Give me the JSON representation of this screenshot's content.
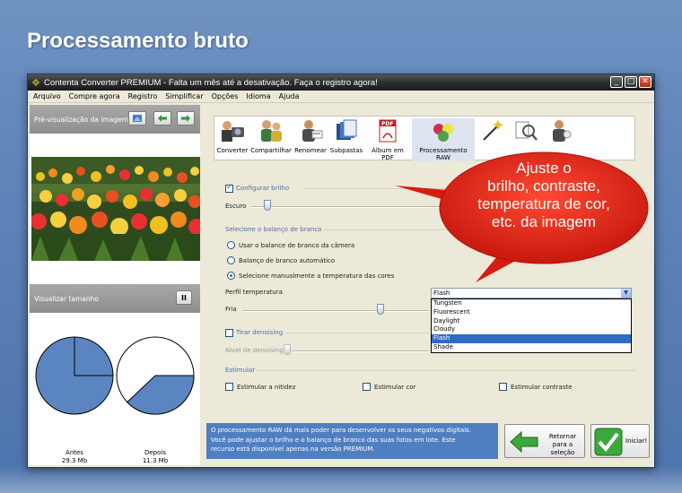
{
  "slide": {
    "title": "Processamento bruto"
  },
  "window": {
    "title": "Contenta Converter PREMIUM  - Falta um mês até a desativação. Faça o registro agora!",
    "buttons": {
      "minimize": "_",
      "maximize": "□",
      "close": "✕"
    }
  },
  "menu": [
    "Arquivo",
    "Compre agora",
    "Registro",
    "Simplificar",
    "Opções",
    "Idioma",
    "Ajuda"
  ],
  "preview": {
    "header": "Pré-visualização da imagem",
    "size_header": "Visualizar tamanho",
    "pause_label": "II"
  },
  "sizes": {
    "before_label": "Antes",
    "before_value": "29.3 Mb",
    "after_label": "Depois",
    "after_value": "11.3 Mb"
  },
  "toolbar": [
    {
      "label": "Converter",
      "icon": "camera-person-icon"
    },
    {
      "label": "Compartilhar",
      "icon": "people-icon"
    },
    {
      "label": "Renomear",
      "icon": "person-rename-icon"
    },
    {
      "label": "Subpastas",
      "icon": "folders-icon"
    },
    {
      "label": "Álbum em PDF",
      "icon": "pdf-icon"
    },
    {
      "label": "Processamento RAW",
      "icon": "color-balls-icon"
    },
    {
      "label": "",
      "icon": "magic-wand-icon"
    },
    {
      "label": "",
      "icon": "magnifier-icon"
    },
    {
      "label": "",
      "icon": "person-gear-icon"
    }
  ],
  "brightness": {
    "checkbox_label": "Configurar brilho",
    "dark_label": "Escuro"
  },
  "white_balance": {
    "group_label": "Selecione o balanço de branco",
    "options": [
      "Usar o balance de branco da câmera",
      "Balanço de branco automático",
      "Selecione manualmente a temperatura das cores"
    ],
    "profile_label": "Perfil temperatura",
    "profile_value": "Flash",
    "profile_options": [
      "Tungsten",
      "Fluorescent",
      "Daylight",
      "Cloudy",
      "Flash",
      "Shade"
    ],
    "cold_label": "Fria"
  },
  "denoise": {
    "checkbox_label": "Tirar denoising",
    "level_label": "Nível de denoising"
  },
  "stimulate": {
    "group_label": "Estimular",
    "options": [
      "Estimular a nitidez",
      "Estimular cor",
      "Estimular contraste"
    ]
  },
  "info_text": [
    "O processamento RAW dá mais poder para desenvolver os seus negativos digitais.",
    "Você pode ajustar o brilho e o balanço de branco das suas fotos em lote. Este",
    "recurso está disponível apenas na versão PREMIUM."
  ],
  "actions": {
    "back_line1": "Retornar",
    "back_line2": "para a seleção",
    "start": "Iniciar!"
  },
  "callout": {
    "lines": [
      "Ajuste o",
      "brilho, contraste,",
      "temperatura de cor,",
      "etc. da imagem"
    ],
    "color": "#e8251a"
  }
}
